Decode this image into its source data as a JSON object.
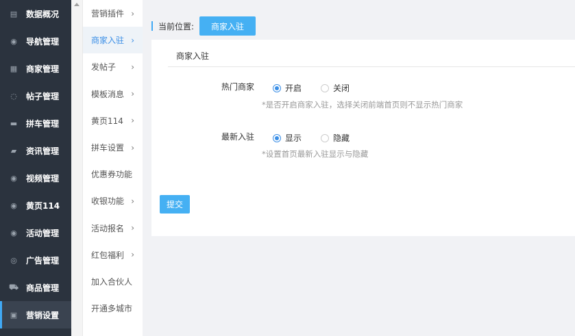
{
  "sidebar": {
    "items": [
      {
        "label": "数据概况",
        "icon": "dashboard-icon",
        "glyph": "▤"
      },
      {
        "label": "导航管理",
        "icon": "compass-icon",
        "glyph": "◉"
      },
      {
        "label": "商家管理",
        "icon": "bank-icon",
        "glyph": "▦"
      },
      {
        "label": "帖子管理",
        "icon": "chat-bubble-icon",
        "glyph": "◌"
      },
      {
        "label": "拼车管理",
        "icon": "car-icon",
        "glyph": "▬"
      },
      {
        "label": "资讯管理",
        "icon": "book-icon",
        "glyph": "▰"
      },
      {
        "label": "视频管理",
        "icon": "compass-icon",
        "glyph": "◉"
      },
      {
        "label": "黄页114",
        "icon": "compass-icon",
        "glyph": "◉"
      },
      {
        "label": "活动管理",
        "icon": "compass-icon",
        "glyph": "◉"
      },
      {
        "label": "广告管理",
        "icon": "lifebuoy-icon",
        "glyph": "◎"
      },
      {
        "label": "商品管理",
        "icon": "cart-icon",
        "glyph": "⛟"
      },
      {
        "label": "营销设置",
        "icon": "gift-icon",
        "glyph": "▣"
      }
    ],
    "active_index": 11
  },
  "submenu": {
    "items": [
      {
        "label": "营销插件",
        "arrow": "›"
      },
      {
        "label": "商家入驻",
        "arrow": "›"
      },
      {
        "label": "发帖子",
        "arrow": "›"
      },
      {
        "label": "模板消息",
        "arrow": "›"
      },
      {
        "label": "黄页114",
        "arrow": "›"
      },
      {
        "label": "拼车设置",
        "arrow": "›"
      },
      {
        "label": "优惠券功能",
        "arrow": ""
      },
      {
        "label": "收银功能",
        "arrow": "›"
      },
      {
        "label": "活动报名",
        "arrow": "›"
      },
      {
        "label": "红包福利",
        "arrow": "›"
      },
      {
        "label": "加入合伙人",
        "arrow": ""
      },
      {
        "label": "开通多城市",
        "arrow": ""
      }
    ],
    "active_index": 1
  },
  "breadcrumb": {
    "label": "当前位置:",
    "current": "商家入驻"
  },
  "panel": {
    "title": "商家入驻",
    "hot": {
      "label": "热门商家",
      "option_on": "开启",
      "option_off": "关闭",
      "selected": "开启",
      "hint": "*是否开启商家入驻，选择关闭前端首页则不显示热门商家"
    },
    "latest": {
      "label": "最新入驻",
      "option_on": "显示",
      "option_off": "隐藏",
      "selected": "显示",
      "hint": "*设置首页最新入驻显示与隐藏"
    },
    "submit": "提交"
  },
  "colors": {
    "accent": "#45b0f3",
    "sidebar_bg": "#2b333e",
    "radio_checked": "#3a8ee6"
  }
}
